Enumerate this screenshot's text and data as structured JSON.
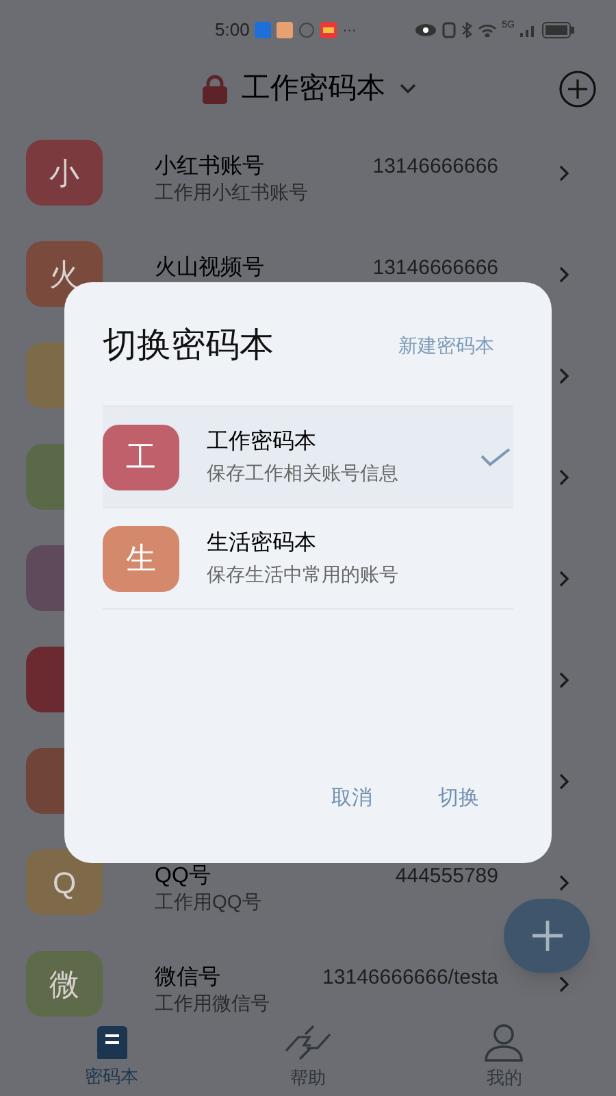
{
  "status_bar": {
    "time": "5:00",
    "more": "···",
    "network": "5G"
  },
  "header": {
    "title": "工作密码本"
  },
  "accounts": [
    {
      "avatar": "小",
      "color": "#7a3a3e",
      "title": "小红书账号",
      "subtitle": "工作用小红书账号",
      "value": "13146666666"
    },
    {
      "avatar": "火",
      "color": "#7a4a3c",
      "title": "火山视频号",
      "value": "13146666666"
    },
    {
      "color": "#7c6a48"
    },
    {
      "color": "#5a6a48"
    },
    {
      "color": "#5e4a5a"
    },
    {
      "color": "#6a2a30"
    },
    {
      "color": "#704438"
    },
    {
      "avatar": "Q",
      "color": "#7e6a48",
      "title": "QQ号",
      "subtitle": "工作用QQ号",
      "value": "444555789"
    },
    {
      "avatar": "微",
      "color": "#5e6a4a",
      "title": "微信号",
      "subtitle": "工作用微信号",
      "value": "13146666666/testa"
    }
  ],
  "dialog": {
    "title": "切换密码本",
    "new_button": "新建密码本",
    "notebooks": [
      {
        "avatar": "工",
        "color": "#c0606a",
        "name": "工作密码本",
        "description": "保存工作相关账号信息",
        "selected": true
      },
      {
        "avatar": "生",
        "color": "#d4896c",
        "name": "生活密码本",
        "description": "保存生活中常用的账号",
        "selected": false
      }
    ],
    "cancel": "取消",
    "confirm": "切换"
  },
  "bottom_nav": [
    {
      "label": "密码本",
      "selected": true
    },
    {
      "label": "帮助",
      "selected": false
    },
    {
      "label": "我的",
      "selected": false
    }
  ]
}
